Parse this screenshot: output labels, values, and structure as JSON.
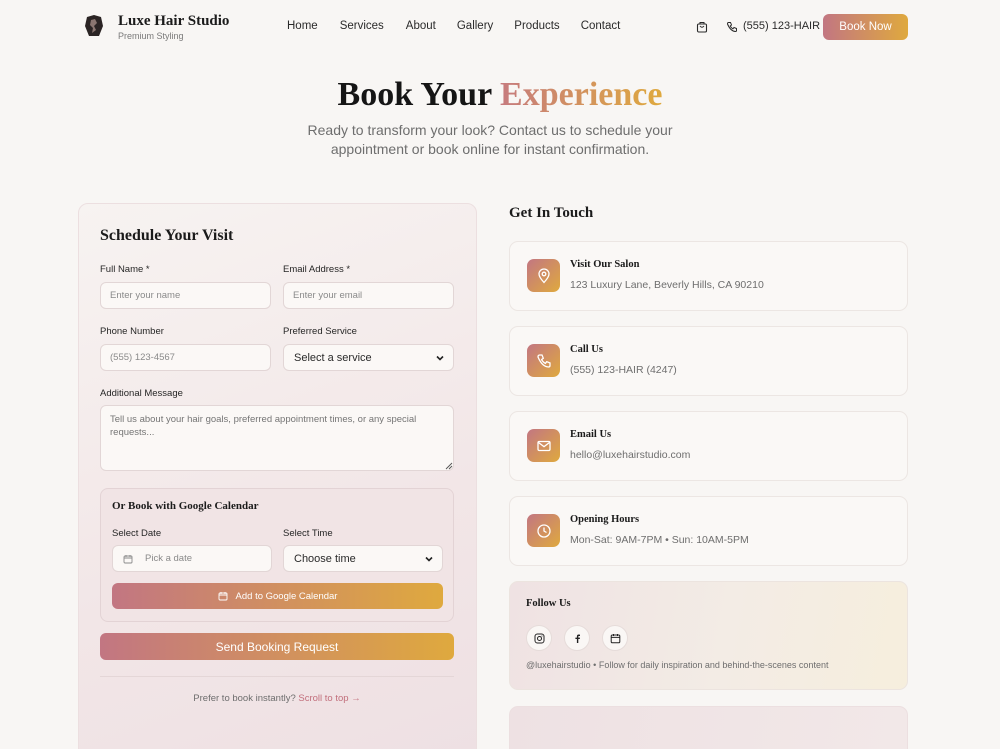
{
  "brand": {
    "name": "Luxe Hair Studio",
    "tagline": "Premium Styling"
  },
  "nav": {
    "items": [
      "Home",
      "Services",
      "About",
      "Gallery",
      "Products",
      "Contact"
    ]
  },
  "header": {
    "phone": "(555) 123-HAIR",
    "cta": "Book Now"
  },
  "hero": {
    "title_part1": "Book Your",
    "title_part2": "Experience",
    "subtitle": "Ready to transform your look? Contact us to schedule your appointment or book online for instant confirmation."
  },
  "form": {
    "title": "Schedule Your Visit",
    "full_name_label": "Full Name *",
    "full_name_placeholder": "Enter your name",
    "email_label": "Email Address *",
    "email_placeholder": "Enter your email",
    "phone_label": "Phone Number",
    "phone_placeholder": "(555) 123-4567",
    "service_label": "Preferred Service",
    "service_value": "Select a service",
    "message_label": "Additional Message",
    "message_placeholder": "Tell us about your hair goals, preferred appointment times, or any special requests...",
    "gcal": {
      "title": "Or Book with Google Calendar",
      "date_label": "Select Date",
      "date_placeholder": "Pick a date",
      "time_label": "Select Time",
      "time_value": "Choose time",
      "button": "Add to Google Calendar"
    },
    "submit": "Send Booking Request",
    "instant_text": "Prefer to book instantly?",
    "instant_link": "Scroll to top →"
  },
  "contact": {
    "title": "Get In Touch",
    "cards": [
      {
        "title": "Visit Our Salon",
        "text": "123 Luxury Lane, Beverly Hills, CA 90210",
        "icon": "map-pin-icon"
      },
      {
        "title": "Call Us",
        "text": "(555) 123-HAIR (4247)",
        "icon": "phone-icon"
      },
      {
        "title": "Email Us",
        "text": "hello@luxehairstudio.com",
        "icon": "mail-icon"
      },
      {
        "title": "Opening Hours",
        "text": "Mon-Sat: 9AM-7PM • Sun: 10AM-5PM",
        "icon": "clock-icon"
      }
    ],
    "follow": {
      "title": "Follow Us",
      "text": "@luxehairstudio • Follow for daily inspiration and behind-the-scenes content",
      "icons": [
        "instagram-icon",
        "facebook-icon",
        "calendar-icon"
      ]
    }
  },
  "colors": {
    "accent_start": "#c27682",
    "accent_end": "#dfa93e",
    "background": "#f8f6f4"
  }
}
